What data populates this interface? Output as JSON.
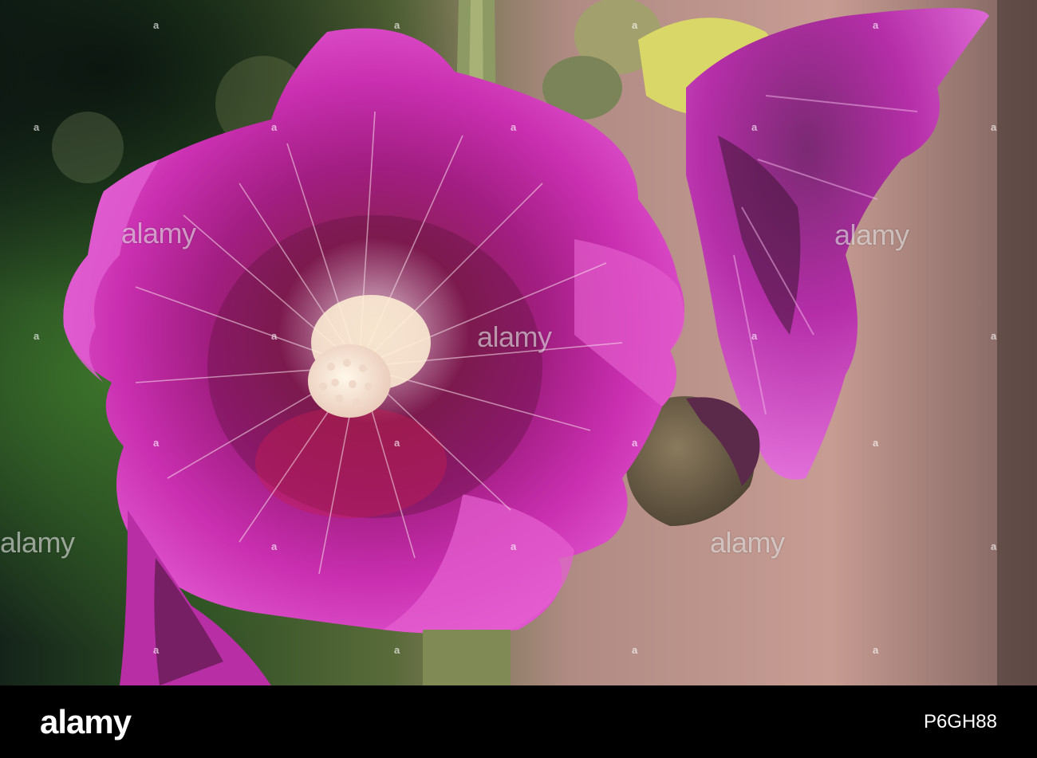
{
  "watermark": {
    "text": "alamy",
    "id_marker": "a"
  },
  "footer": {
    "brand": "alamy",
    "image_id": "P6GH88"
  },
  "palette": {
    "petal": "#c0259c",
    "petal_light": "#e04ec6",
    "petal_dark": "#6c1242",
    "background_left": "#1d3a1c",
    "background_right": "#c49a90",
    "stamen": "#f4e4d2",
    "footer_bg": "#000000"
  }
}
